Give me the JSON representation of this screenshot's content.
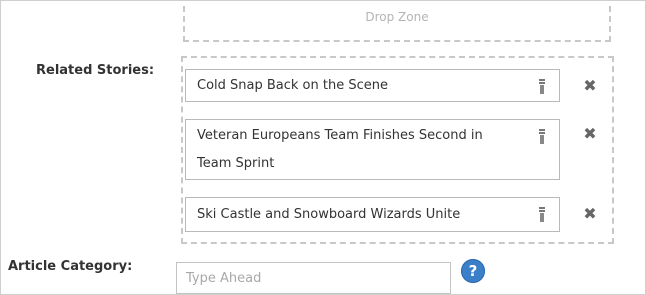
{
  "drop_zone": {
    "label": "Drop Zone"
  },
  "related_stories": {
    "label": "Related Stories:",
    "items": [
      {
        "title": "Cold Snap Back on the Scene"
      },
      {
        "title": "Veteran Europeans Team Finishes Second in Team Sprint"
      },
      {
        "title": "Ski Castle and Snowboard Wizards Unite"
      }
    ],
    "drag_icon": "drag-handle-icon",
    "remove_icon": "close-x-icon",
    "remove_glyph": "✖"
  },
  "article_category": {
    "label": "Article Category:",
    "placeholder": "Type Ahead",
    "value": "",
    "help_icon": "help-question-icon",
    "help_glyph": "?"
  },
  "colors": {
    "border_dashed": "#c8c8c8",
    "help_blue": "#3a7fc7",
    "text": "#333333"
  }
}
